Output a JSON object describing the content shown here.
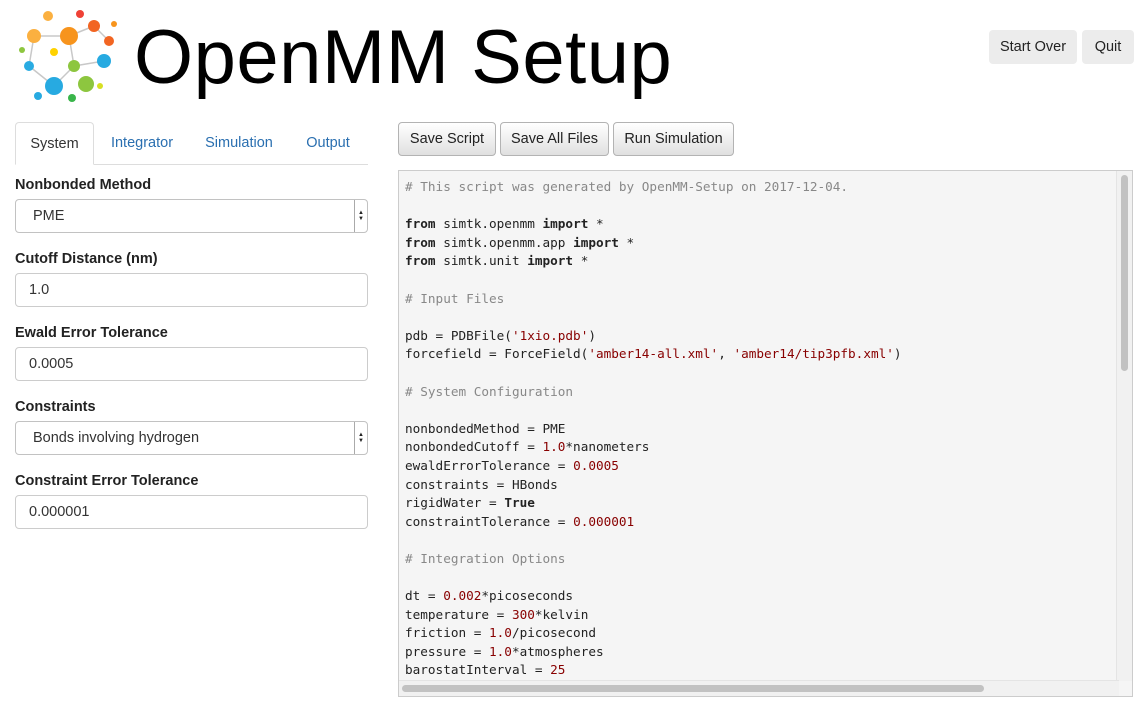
{
  "header": {
    "title": "OpenMM Setup",
    "start_over_label": "Start Over",
    "quit_label": "Quit"
  },
  "tabs": [
    "System",
    "Integrator",
    "Simulation",
    "Output"
  ],
  "form": {
    "nonbonded_method": {
      "label": "Nonbonded Method",
      "value": "PME"
    },
    "cutoff_distance": {
      "label": "Cutoff Distance (nm)",
      "value": "1.0"
    },
    "ewald_error": {
      "label": "Ewald Error Tolerance",
      "value": "0.0005"
    },
    "constraints": {
      "label": "Constraints",
      "value": "Bonds involving hydrogen"
    },
    "constraint_error": {
      "label": "Constraint Error Tolerance",
      "value": "0.000001"
    }
  },
  "toolbar": {
    "save_script": "Save Script",
    "save_all_files": "Save All Files",
    "run_simulation": "Run Simulation"
  },
  "script_lines": [
    [
      [
        "cm",
        "# This script was generated by OpenMM-Setup on 2017-12-04."
      ]
    ],
    [],
    [
      [
        "kw",
        "from"
      ],
      [
        "tx",
        " simtk.openmm "
      ],
      [
        "kw",
        "import"
      ],
      [
        "tx",
        " *"
      ]
    ],
    [
      [
        "kw",
        "from"
      ],
      [
        "tx",
        " simtk.openmm.app "
      ],
      [
        "kw",
        "import"
      ],
      [
        "tx",
        " *"
      ]
    ],
    [
      [
        "kw",
        "from"
      ],
      [
        "tx",
        " simtk.unit "
      ],
      [
        "kw",
        "import"
      ],
      [
        "tx",
        " *"
      ]
    ],
    [],
    [
      [
        "cm",
        "# Input Files"
      ]
    ],
    [],
    [
      [
        "tx",
        "pdb = PDBFile("
      ],
      [
        "st",
        "'1xio.pdb'"
      ],
      [
        "tx",
        ")"
      ]
    ],
    [
      [
        "tx",
        "forcefield = ForceField("
      ],
      [
        "st",
        "'amber14-all.xml'"
      ],
      [
        "tx",
        ", "
      ],
      [
        "st",
        "'amber14/tip3pfb.xml'"
      ],
      [
        "tx",
        ")"
      ]
    ],
    [],
    [
      [
        "cm",
        "# System Configuration"
      ]
    ],
    [],
    [
      [
        "tx",
        "nonbondedMethod = PME"
      ]
    ],
    [
      [
        "tx",
        "nonbondedCutoff = "
      ],
      [
        "nm",
        "1.0"
      ],
      [
        "tx",
        "*nanometers"
      ]
    ],
    [
      [
        "tx",
        "ewaldErrorTolerance = "
      ],
      [
        "nm",
        "0.0005"
      ]
    ],
    [
      [
        "tx",
        "constraints = HBonds"
      ]
    ],
    [
      [
        "tx",
        "rigidWater = "
      ],
      [
        "kw",
        "True"
      ]
    ],
    [
      [
        "tx",
        "constraintTolerance = "
      ],
      [
        "nm",
        "0.000001"
      ]
    ],
    [],
    [
      [
        "cm",
        "# Integration Options"
      ]
    ],
    [],
    [
      [
        "tx",
        "dt = "
      ],
      [
        "nm",
        "0.002"
      ],
      [
        "tx",
        "*picoseconds"
      ]
    ],
    [
      [
        "tx",
        "temperature = "
      ],
      [
        "nm",
        "300"
      ],
      [
        "tx",
        "*kelvin"
      ]
    ],
    [
      [
        "tx",
        "friction = "
      ],
      [
        "nm",
        "1.0"
      ],
      [
        "tx",
        "/picosecond"
      ]
    ],
    [
      [
        "tx",
        "pressure = "
      ],
      [
        "nm",
        "1.0"
      ],
      [
        "tx",
        "*atmospheres"
      ]
    ],
    [
      [
        "tx",
        "barostatInterval = "
      ],
      [
        "nm",
        "25"
      ]
    ]
  ]
}
